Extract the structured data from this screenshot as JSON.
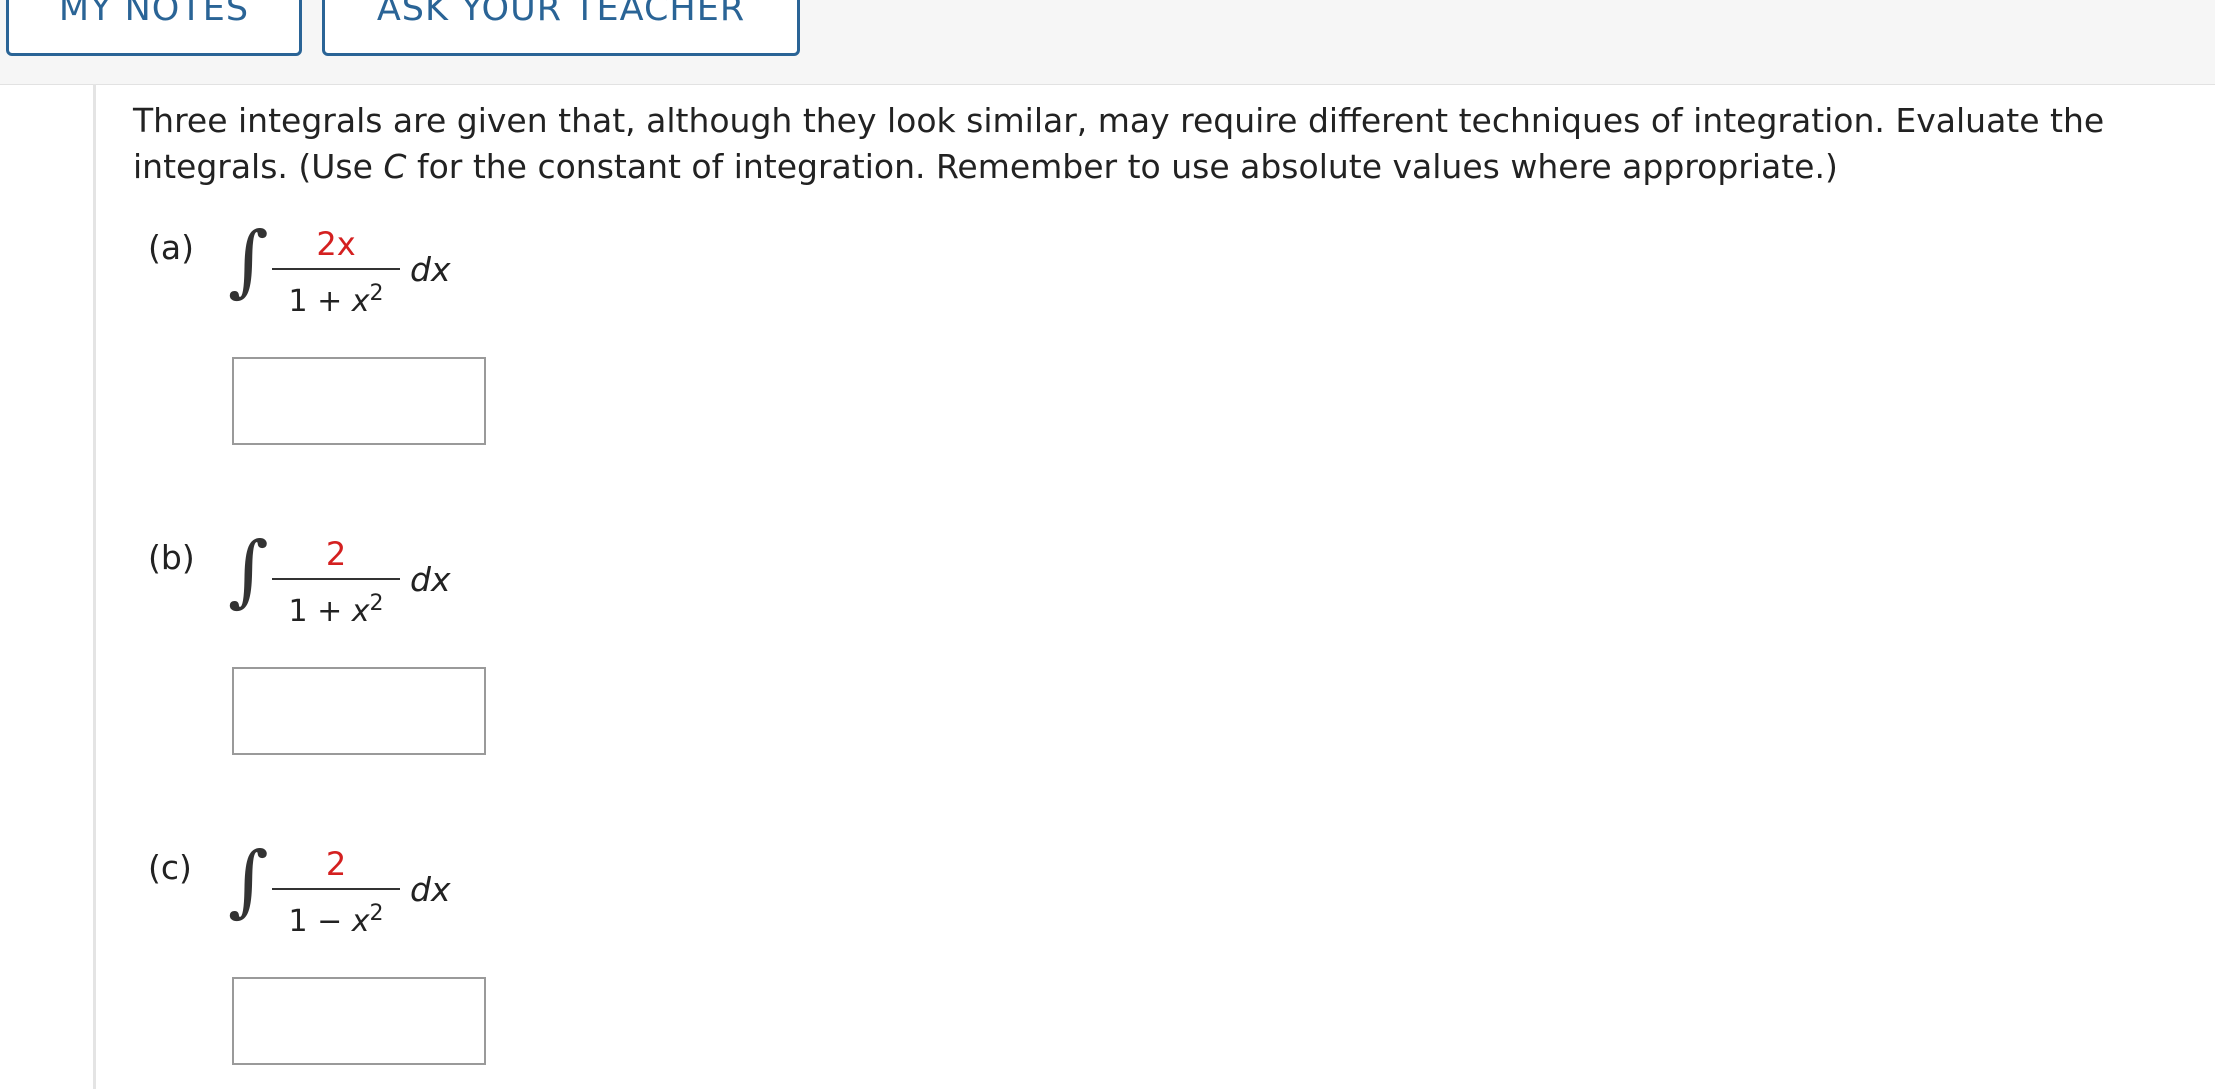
{
  "toolbar": {
    "my_notes_label": "MY NOTES",
    "ask_teacher_label": "ASK YOUR TEACHER",
    "accent_color": "#2a6496"
  },
  "question": {
    "text_before_c": "Three integrals are given that, although they look similar, may require different techniques of integration. Evaluate the integrals. (Use ",
    "c_symbol": "C",
    "text_after_c": " for the constant of integration. Remember to use absolute values where appropriate.)"
  },
  "parts": [
    {
      "label": "(a)",
      "integral_symbol": "∫",
      "numerator": "2x",
      "denominator_constant": "1",
      "denominator_operator": "+",
      "denominator_variable": "x",
      "denominator_exponent": "2",
      "differential": "dx",
      "answer_value": ""
    },
    {
      "label": "(b)",
      "integral_symbol": "∫",
      "numerator": "2",
      "denominator_constant": "1",
      "denominator_operator": "+",
      "denominator_variable": "x",
      "denominator_exponent": "2",
      "differential": "dx",
      "answer_value": ""
    },
    {
      "label": "(c)",
      "integral_symbol": "∫",
      "numerator": "2",
      "denominator_constant": "1",
      "denominator_operator": "−",
      "denominator_variable": "x",
      "denominator_exponent": "2",
      "differential": "dx",
      "answer_value": ""
    }
  ],
  "colors": {
    "numerator_highlight": "#d42020",
    "text": "#222222"
  }
}
